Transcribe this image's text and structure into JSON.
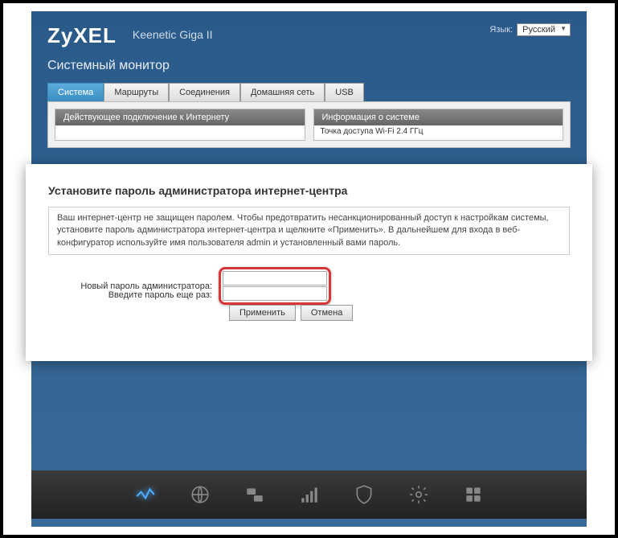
{
  "header": {
    "logo": "ZyXEL",
    "product": "Keenetic Giga II",
    "language_label": "Язык:",
    "language_value": "Русский"
  },
  "page": {
    "subtitle": "Системный монитор"
  },
  "tabs": [
    {
      "label": "Система",
      "active": true
    },
    {
      "label": "Маршруты",
      "active": false
    },
    {
      "label": "Соединения",
      "active": false
    },
    {
      "label": "Домашняя сеть",
      "active": false
    },
    {
      "label": "USB",
      "active": false
    }
  ],
  "panels": {
    "left_header": "Действующее подключение к Интернету",
    "right_header": "Информация о системе",
    "right_body_hint": "Точка доступа Wi-Fi 2.4 ГГц"
  },
  "modal": {
    "title": "Установите пароль администратора интернет-центра",
    "description": "Ваш интернет-центр не защищен паролем. Чтобы предотвратить несанкционированный доступ к настройкам системы, установите пароль администратора интернет-центра и щелкните «Применить».\nВ дальнейшем для входа в веб-конфигуратор используйте имя пользователя admin и установленный вами пароль.",
    "label_new_password": "Новый пароль администратора:",
    "label_repeat_password": "Введите пароль еще раз:",
    "btn_apply": "Применить",
    "btn_cancel": "Отмена"
  }
}
